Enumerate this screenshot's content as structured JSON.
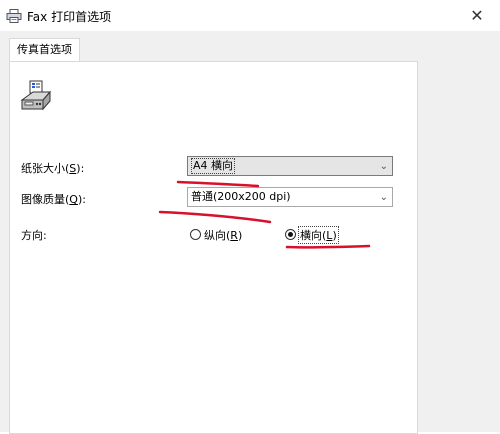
{
  "window": {
    "title": "Fax 打印首选项",
    "close_glyph": "✕"
  },
  "tabs": [
    {
      "label": "传真首选项",
      "active": true
    }
  ],
  "form": {
    "paper_size": {
      "label_text": "纸张大小(",
      "mnemonic": "S",
      "label_end": "):",
      "value": "A4 横向"
    },
    "image_quality": {
      "label_text": "图像质量(",
      "mnemonic": "Q",
      "label_end": "):",
      "value": "普通(200x200 dpi)"
    },
    "orientation": {
      "label": "方向:",
      "options": [
        {
          "text": "纵向(",
          "mnemonic": "R",
          "end": ")",
          "selected": false
        },
        {
          "text": "横向(",
          "mnemonic": "L",
          "end": ")",
          "selected": true
        }
      ]
    }
  },
  "colors": {
    "annotation_red": "#d8102b",
    "window_bg": "#f0f0f0"
  },
  "icons": {
    "title": "printer-icon",
    "dialog": "fax-machine-icon",
    "dropdown": "chevron-down-icon"
  }
}
